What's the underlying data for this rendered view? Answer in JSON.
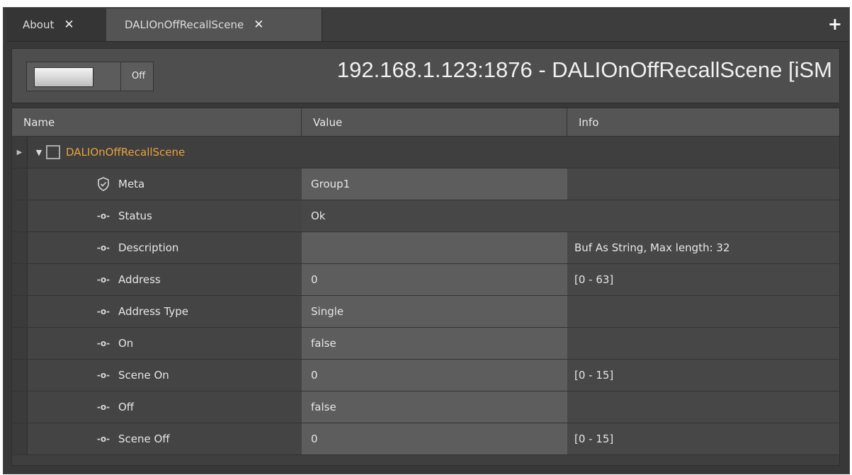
{
  "tabs": [
    {
      "label": "About",
      "close": "✕",
      "active": false
    },
    {
      "label": "DALIOnOffRecallScene",
      "close": "✕",
      "active": true
    }
  ],
  "tabbar": {
    "add": "+"
  },
  "header": {
    "toggle_state": "Off",
    "title": "192.168.1.123:1876 - DALIOnOffRecallScene [iSM"
  },
  "columns": {
    "name": "Name",
    "value": "Value",
    "info": "Info"
  },
  "root": {
    "name": "DALIOnOffRecallScene"
  },
  "rows": [
    {
      "name": "Meta",
      "value": "Group1",
      "info": "",
      "icon": "shield-icon"
    },
    {
      "name": "Status",
      "value": "Ok",
      "info": "",
      "icon": "slot-icon"
    },
    {
      "name": "Description",
      "value": "",
      "info": "Buf As String, Max length: 32",
      "icon": "slot-icon"
    },
    {
      "name": "Address",
      "value": "0",
      "info": "[0 - 63]",
      "icon": "slot-icon"
    },
    {
      "name": "Address Type",
      "value": "Single",
      "info": "",
      "icon": "slot-icon"
    },
    {
      "name": "On",
      "value": "false",
      "info": "",
      "icon": "slot-icon"
    },
    {
      "name": "Scene On",
      "value": "0",
      "info": "[0 - 15]",
      "icon": "slot-icon"
    },
    {
      "name": "Off",
      "value": "false",
      "info": "",
      "icon": "slot-icon"
    },
    {
      "name": "Scene Off",
      "value": "0",
      "info": "[0 - 15]",
      "icon": "slot-icon"
    }
  ],
  "colors": {
    "accent": "#e8a33a",
    "background": "#383838",
    "editable": "#5d5d5d"
  }
}
